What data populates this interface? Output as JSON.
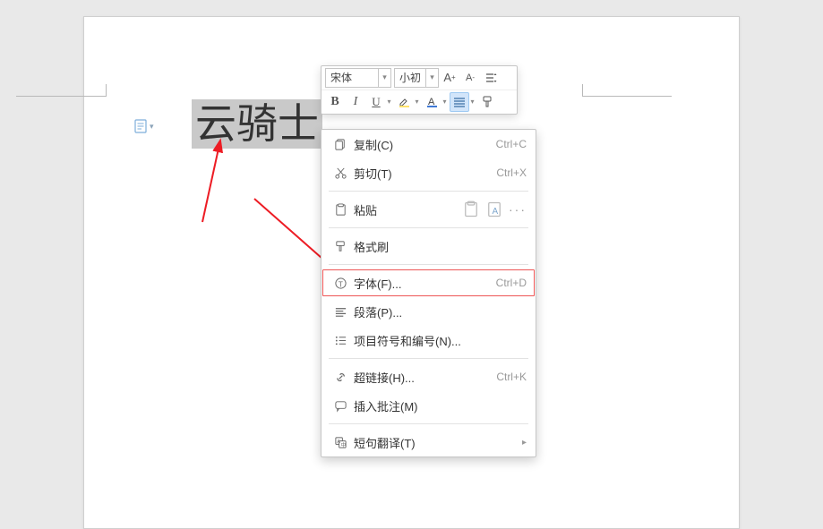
{
  "text": {
    "selected": "云骑士"
  },
  "mini_toolbar": {
    "font": "宋体",
    "size": "小初",
    "inc": "A+",
    "dec": "A-",
    "btns": {
      "bold": "B",
      "italic": "I",
      "underline": "U"
    }
  },
  "ctx": {
    "copy": {
      "label": "复制(C)",
      "shortcut": "Ctrl+C"
    },
    "cut": {
      "label": "剪切(T)",
      "shortcut": "Ctrl+X"
    },
    "paste": {
      "label": "粘贴"
    },
    "format_painter": {
      "label": "格式刷"
    },
    "font": {
      "label": "字体(F)...",
      "shortcut": "Ctrl+D"
    },
    "paragraph": {
      "label": "段落(P)..."
    },
    "bullets": {
      "label": "项目符号和编号(N)..."
    },
    "hyperlink": {
      "label": "超链接(H)...",
      "shortcut": "Ctrl+K"
    },
    "comment": {
      "label": "插入批注(M)"
    },
    "translate": {
      "label": "短句翻译(T)"
    }
  }
}
